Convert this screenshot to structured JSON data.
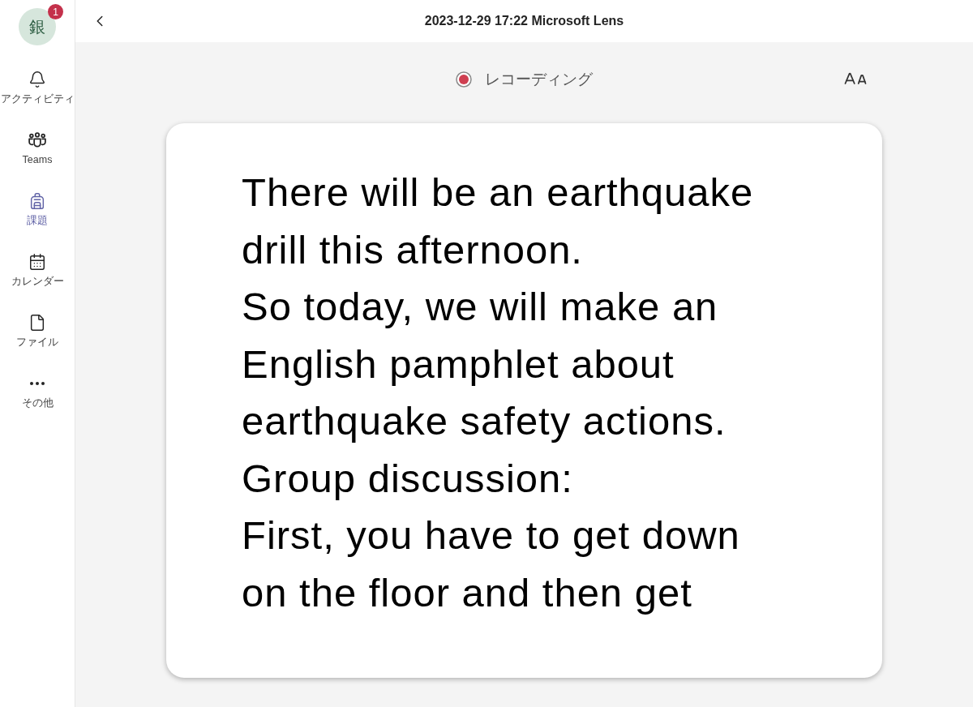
{
  "sidebar": {
    "avatar": {
      "initial": "銀",
      "badge": "1"
    },
    "items": [
      {
        "label": "アクティビティ",
        "selected": false
      },
      {
        "label": "Teams",
        "selected": false
      },
      {
        "label": "課題",
        "selected": true
      },
      {
        "label": "カレンダー",
        "selected": false
      },
      {
        "label": "ファイル",
        "selected": false
      },
      {
        "label": "その他",
        "selected": false
      }
    ]
  },
  "header": {
    "title": "2023-12-29 17:22 Microsoft Lens"
  },
  "reader": {
    "status": "レコーディング",
    "lines": [
      "There will be an earthquake",
      "drill this afternoon.",
      "So today, we will make an",
      "English pamphlet about",
      "earthquake safety actions.",
      "Group discussion:",
      "First, you have to get down",
      "on the floor and then get"
    ]
  }
}
